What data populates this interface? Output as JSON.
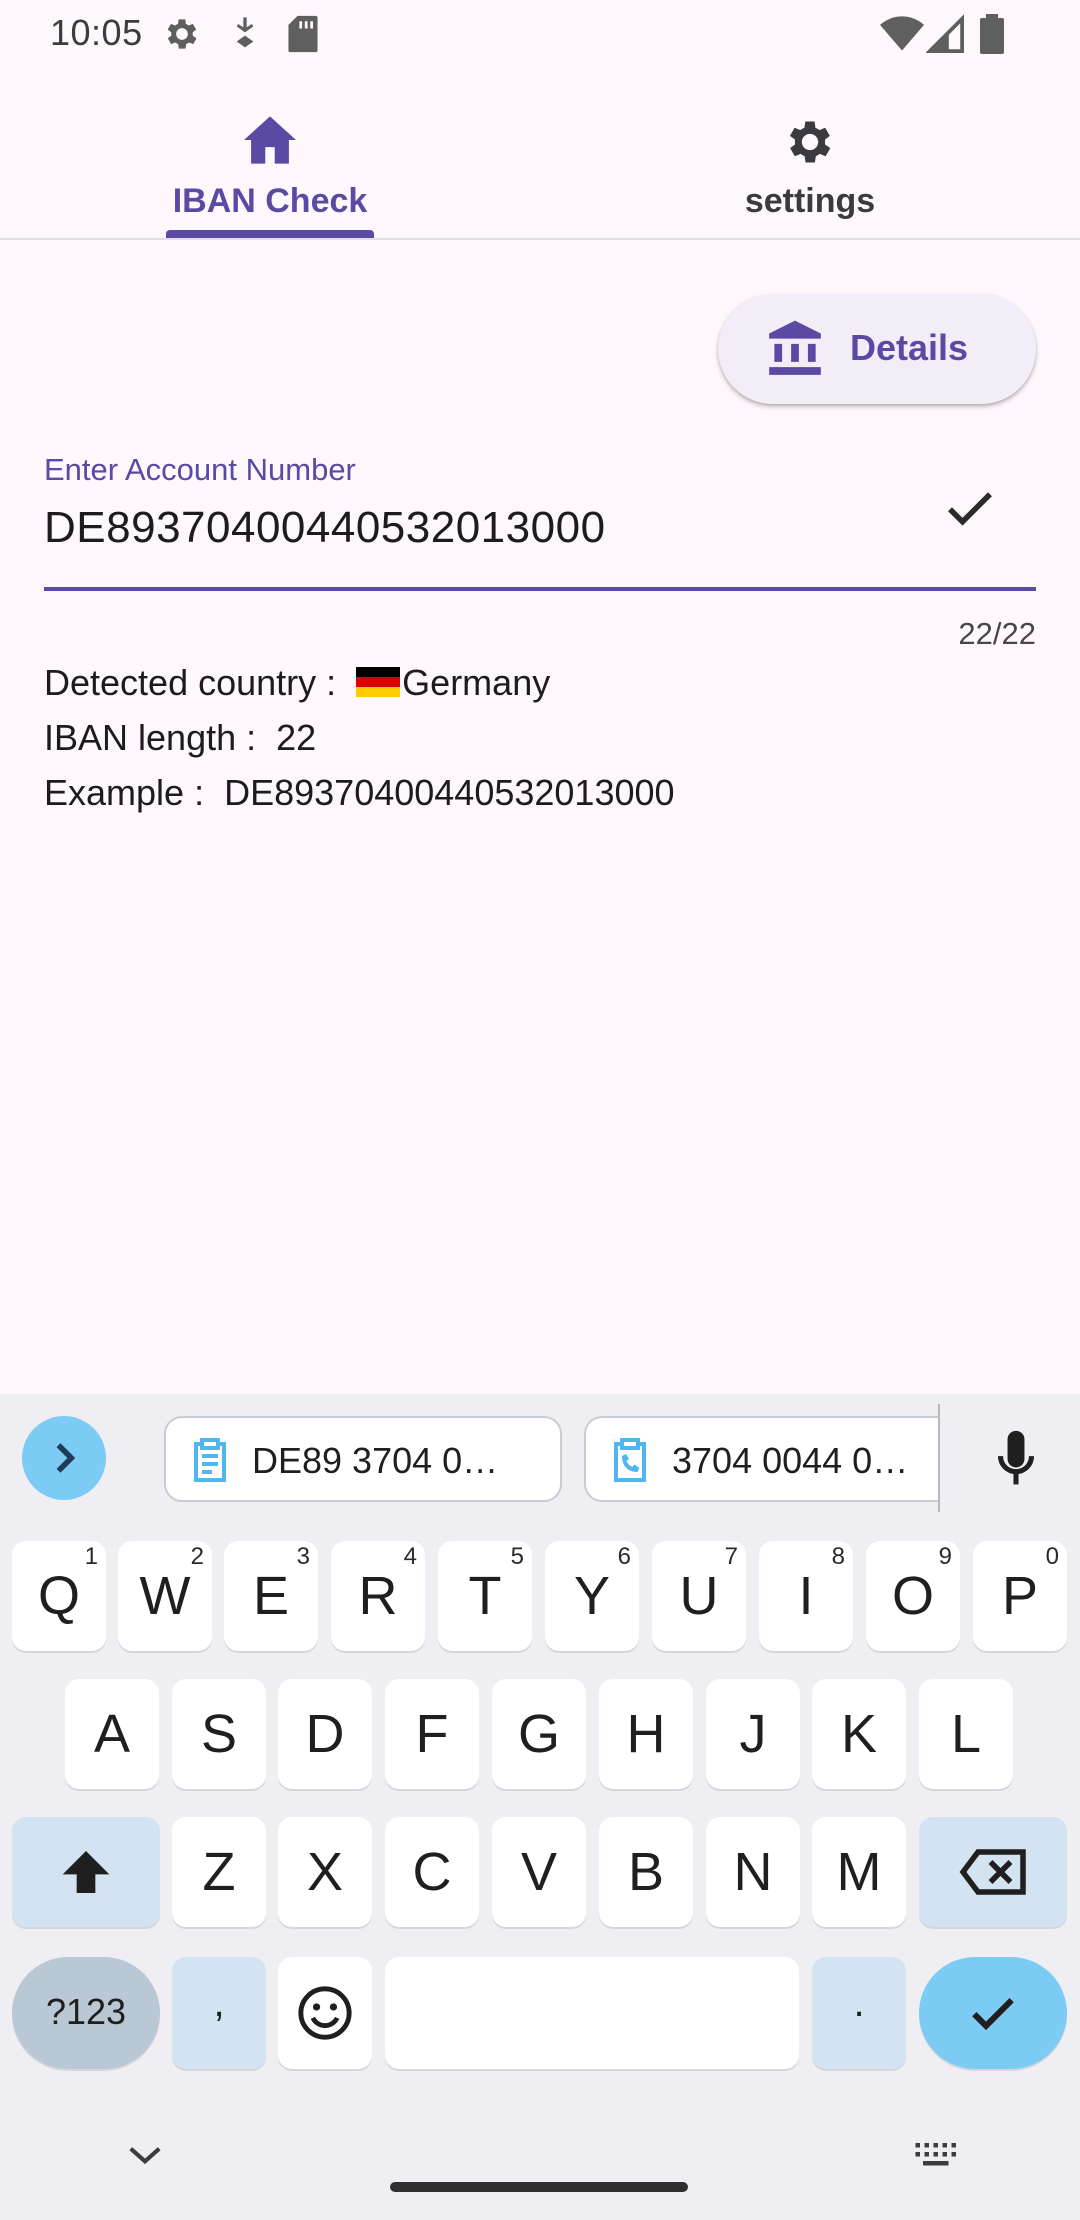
{
  "status_bar": {
    "time": "10:05",
    "left_icons": [
      "settings-gear-icon",
      "data-saver-icon",
      "sd-card-icon"
    ],
    "right_icons": [
      "wifi-icon",
      "cell-signal-icon",
      "battery-icon"
    ]
  },
  "tabs": [
    {
      "label": "IBAN Check",
      "icon": "home-icon",
      "selected": true
    },
    {
      "label": "settings",
      "icon": "gear-icon",
      "selected": false
    }
  ],
  "details_button": {
    "label": "Details",
    "icon": "bank-icon"
  },
  "account_field": {
    "label": "Enter Account Number",
    "value": "DE89370400440532013000",
    "counter": "22/22",
    "trailing_icon": "check-icon"
  },
  "info": {
    "country_label": "Detected country :",
    "country_value": "Germany",
    "country_flag": "flag-germany-icon",
    "length_label": "IBAN length :",
    "length_value": "22",
    "example_label": "Example :",
    "example_value": "DE89370400440532013000"
  },
  "keyboard": {
    "clipboard": [
      "DE89 3704 0…",
      "3704 0044 0…"
    ],
    "rows": [
      [
        {
          "k": "Q",
          "n": "1"
        },
        {
          "k": "W",
          "n": "2"
        },
        {
          "k": "E",
          "n": "3"
        },
        {
          "k": "R",
          "n": "4"
        },
        {
          "k": "T",
          "n": "5"
        },
        {
          "k": "Y",
          "n": "6"
        },
        {
          "k": "U",
          "n": "7"
        },
        {
          "k": "I",
          "n": "8"
        },
        {
          "k": "O",
          "n": "9"
        },
        {
          "k": "P",
          "n": "0"
        }
      ],
      [
        "A",
        "S",
        "D",
        "F",
        "G",
        "H",
        "J",
        "K",
        "L"
      ],
      [
        "Z",
        "X",
        "C",
        "V",
        "B",
        "N",
        "M"
      ]
    ],
    "symbols_label": "?123",
    "comma_label": ",",
    "period_label": "."
  },
  "colors": {
    "primary": "#5A4AA3",
    "background": "#FEF7FC",
    "keyboard_bg": "#EFEEF3",
    "accent_key": "#7CCBF4"
  }
}
